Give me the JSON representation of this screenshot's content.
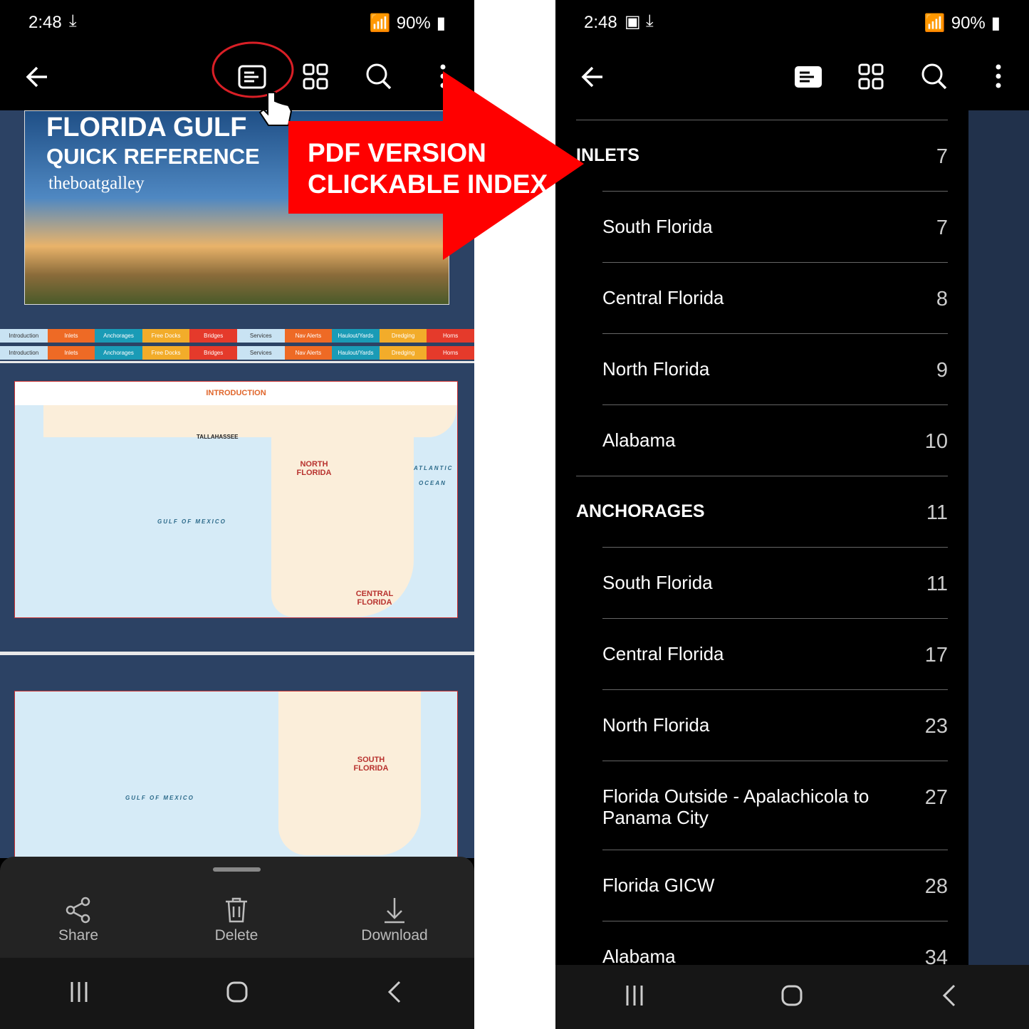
{
  "left": {
    "status": {
      "time": "2:48",
      "battery": "90%"
    },
    "toolbar": {
      "icons": [
        "back-arrow-icon",
        "toc-icon",
        "grid-icon",
        "search-icon",
        "more-icon"
      ]
    },
    "cover": {
      "title": "FLORIDA GULF",
      "subtitle": "QUICK REFERENCE",
      "brand": "theboatgalley"
    },
    "tabs": [
      {
        "label": "Introduction",
        "color": "#c9e3f3",
        "text": "#333"
      },
      {
        "label": "Inlets",
        "color": "#ee6a25",
        "text": "#fff"
      },
      {
        "label": "Anchorages",
        "color": "#1a9bb6",
        "text": "#fff"
      },
      {
        "label": "Free Docks",
        "color": "#f2ac2a",
        "text": "#fff"
      },
      {
        "label": "Bridges",
        "color": "#e53a2b",
        "text": "#fff"
      },
      {
        "label": "Services",
        "color": "#c9e3f3",
        "text": "#333"
      },
      {
        "label": "Nav Alerts",
        "color": "#ee6a25",
        "text": "#fff"
      },
      {
        "label": "Haulout/Yards",
        "color": "#1a9bb6",
        "text": "#fff"
      },
      {
        "label": "Dredging",
        "color": "#f2ac2a",
        "text": "#fff"
      },
      {
        "label": "Horns",
        "color": "#e53a2b",
        "text": "#fff"
      }
    ],
    "map1": {
      "heading": "INTRODUCTION",
      "city": "TALLAHASSEE",
      "north": "NORTH FLORIDA",
      "central": "CENTRAL FLORIDA",
      "gulf": "GULF OF MEXICO",
      "atlantic": "ATLANTIC",
      "ocean": "OCEAN"
    },
    "map2": {
      "south": "SOUTH FLORIDA",
      "gulf": "GULF OF MEXICO"
    },
    "sheet": {
      "share": "Share",
      "delete": "Delete",
      "download": "Download"
    }
  },
  "annotation": {
    "line1": "PDF VERSION",
    "line2": "CLICKABLE INDEX",
    "color": "#ff0000"
  },
  "right": {
    "status": {
      "time": "2:48",
      "battery": "90%"
    },
    "index": [
      {
        "label": "INLETS",
        "page": "7",
        "level": "head"
      },
      {
        "label": "South Florida",
        "page": "7",
        "level": "sub"
      },
      {
        "label": "Central Florida",
        "page": "8",
        "level": "sub"
      },
      {
        "label": "North Florida",
        "page": "9",
        "level": "sub"
      },
      {
        "label": "Alabama",
        "page": "10",
        "level": "sub"
      },
      {
        "label": "ANCHORAGES",
        "page": "11",
        "level": "head"
      },
      {
        "label": "South Florida",
        "page": "11",
        "level": "sub"
      },
      {
        "label": "Central Florida",
        "page": "17",
        "level": "sub"
      },
      {
        "label": "North Florida",
        "page": "23",
        "level": "sub"
      },
      {
        "label": "Florida Outside - Apalachicola to Panama City",
        "page": "27",
        "level": "sub"
      },
      {
        "label": "Florida GICW",
        "page": "28",
        "level": "sub"
      },
      {
        "label": "Alabama",
        "page": "34",
        "level": "sub"
      }
    ]
  }
}
